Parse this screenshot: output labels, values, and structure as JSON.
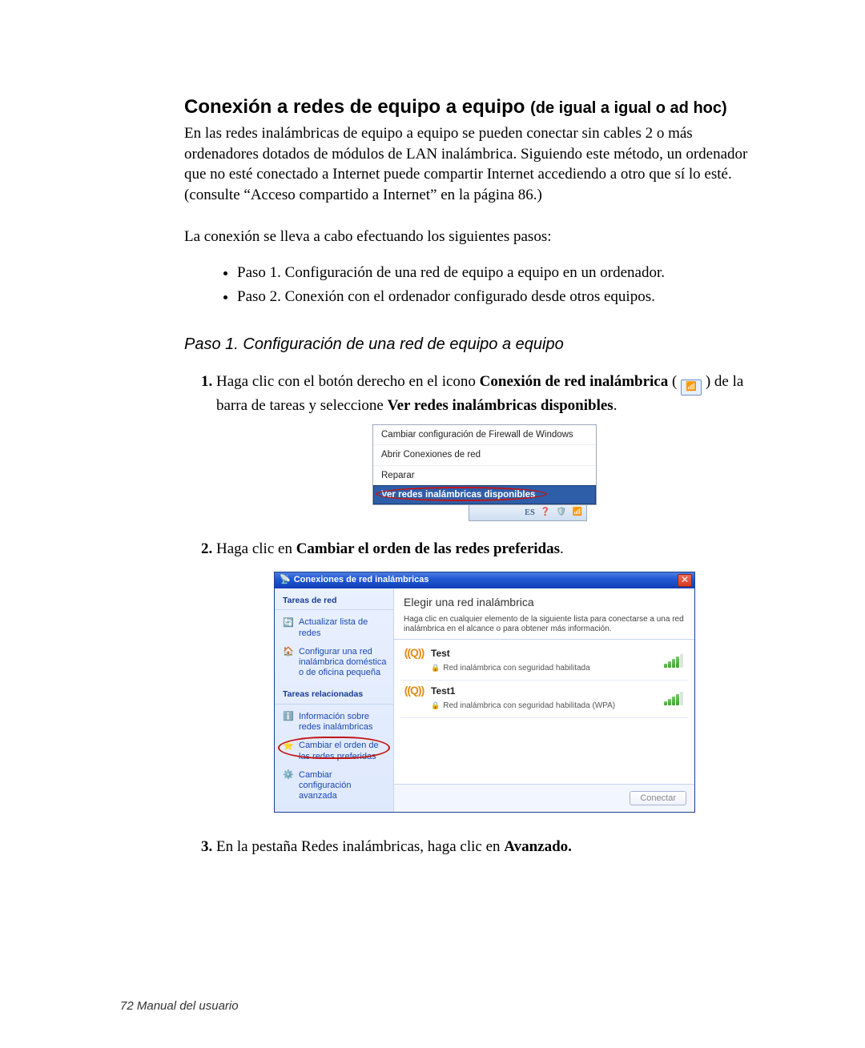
{
  "title": {
    "main": "Conexión a redes de equipo a equipo ",
    "paren": "(de igual a igual o ad hoc)"
  },
  "intro": "En las redes inalámbricas de equipo a equipo se pueden conectar sin cables 2 o más ordenadores dotados de módulos de LAN inalámbrica. Siguiendo este método, un ordenador que no esté conectado a Internet puede compartir Internet accediendo a otro que sí lo esté. (consulte “Acceso compartido a Internet” en la página 86.)",
  "lead": "La conexión se lleva a cabo efectuando los siguientes pasos:",
  "steps": [
    "Paso 1. Configuración de una red de equipo a equipo en un ordenador.",
    "Paso 2. Conexión con el ordenador configurado desde otros equipos."
  ],
  "paso1_title": "Paso 1. Configuración de una red de equipo a equipo",
  "proc1": {
    "pre": "Haga clic con el botón derecho en el icono ",
    "bold1": "Conexión de red inalámbrica",
    "mid": " ( ",
    "after_icon": " ) de la barra de tareas y seleccione ",
    "bold2": "Ver redes inalámbricas disponibles",
    "end": "."
  },
  "ctx_menu": {
    "items": [
      "Cambiar configuración de Firewall de Windows",
      "Abrir Conexiones de red",
      "Reparar",
      "Ver redes inalámbricas disponibles"
    ],
    "tray_lang": "ES"
  },
  "proc2": {
    "pre": "Haga clic en ",
    "bold": "Cambiar el orden de las redes preferidas",
    "end": "."
  },
  "dialog": {
    "title": "Conexiones de red inalámbricas",
    "side": {
      "group1": "Tareas de red",
      "refresh": "Actualizar lista de redes",
      "setup": "Configurar una red inalámbrica doméstica o de oficina pequeña",
      "group2": "Tareas relacionadas",
      "info": "Información sobre redes inalámbricas",
      "order": "Cambiar el orden de las redes preferidas",
      "adv": "Cambiar configuración avanzada"
    },
    "main": {
      "heading": "Elegir una red inalámbrica",
      "note": "Haga clic en cualquier elemento de la siguiente lista para conectarse a una red inalámbrica en el alcance o para obtener más información.",
      "networks": [
        {
          "name": "Test",
          "sub": "Red inalámbrica con seguridad habilitada"
        },
        {
          "name": "Test1",
          "sub": "Red inalámbrica con seguridad habilitada (WPA)"
        }
      ],
      "connect": "Conectar"
    }
  },
  "proc3": {
    "pre": "En la pestaña Redes inalámbricas, haga clic en ",
    "bold": "Avanzado."
  },
  "pagenum": "72  Manual del usuario"
}
